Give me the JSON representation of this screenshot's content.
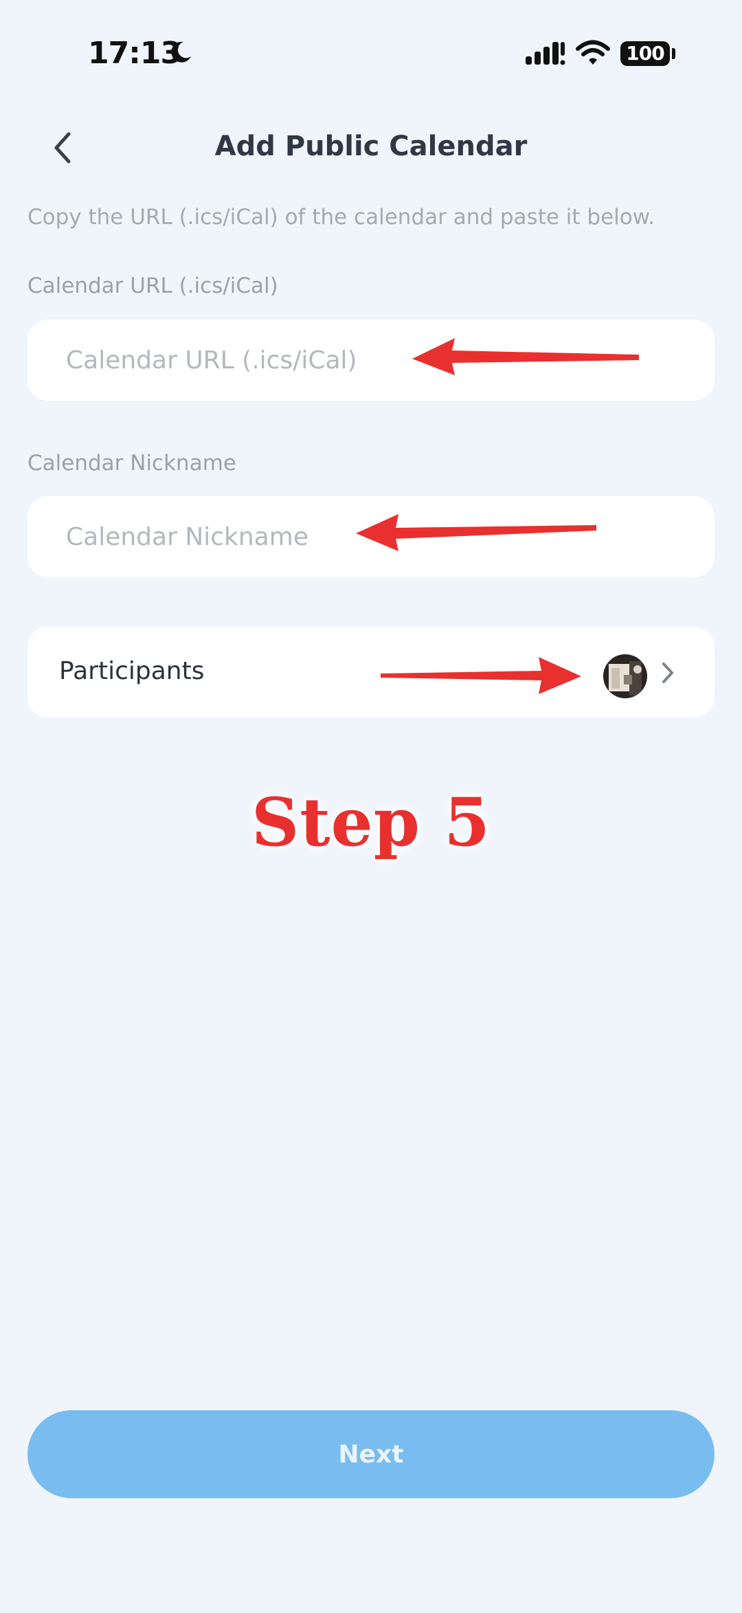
{
  "status_bar": {
    "time": "17:13",
    "battery": "100",
    "icons": [
      "moon-icon",
      "signal-icon",
      "wifi-icon",
      "battery-icon"
    ]
  },
  "header": {
    "title": "Add Public Calendar",
    "back_icon": "chevron-left-icon"
  },
  "instruction": "Copy the URL (.ics/iCal) of the calendar and paste it below.",
  "form": {
    "url_label": "Calendar URL (.ics/iCal)",
    "url_placeholder": "Calendar URL (.ics/iCal)",
    "url_value": "",
    "nickname_label": "Calendar Nickname",
    "nickname_placeholder": "Calendar Nickname",
    "nickname_value": ""
  },
  "participants": {
    "label": "Participants",
    "chevron_icon": "chevron-right-icon"
  },
  "annotation": {
    "step_label": "Step 5",
    "arrow_color": "#e8302f"
  },
  "footer": {
    "next_label": "Next",
    "next_color": "#79bdf0"
  }
}
